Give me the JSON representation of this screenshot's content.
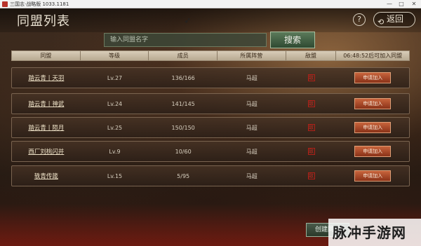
{
  "window": {
    "title": "三国志·战略版 1033.1181",
    "minimize": "—",
    "maximize": "□",
    "close": "✕"
  },
  "header": {
    "title": "同盟列表",
    "help": "?",
    "back_label": "返回",
    "back_icon": "⟲"
  },
  "search": {
    "placeholder": "输入同盟名字",
    "button": "搜索"
  },
  "columns": [
    "同盟",
    "等级",
    "成员",
    "所属阵营",
    "敌盟",
    "06:48:52后可加入同盟"
  ],
  "rows": [
    {
      "name": "踏云青丨天羽",
      "level": "Lv.27",
      "members": "136/166",
      "faction": "马超",
      "hostile": "敌",
      "action": "申请加入"
    },
    {
      "name": "踏云青丨神武",
      "level": "Lv.24",
      "members": "141/145",
      "faction": "马超",
      "hostile": "敌",
      "action": "申请加入"
    },
    {
      "name": "踏云青丨陨月",
      "level": "Lv.25",
      "members": "150/150",
      "faction": "马超",
      "hostile": "敌",
      "action": "申请加入"
    },
    {
      "name": "西厂刘桃闪并",
      "level": "Lv.9",
      "members": "10/60",
      "faction": "马超",
      "hostile": "敌",
      "action": "申请加入"
    },
    {
      "name": "轶青传箴",
      "level": "Lv.15",
      "members": "5/95",
      "faction": "马超",
      "hostile": "敌",
      "action": "申请加入"
    }
  ],
  "footer": {
    "create_button": "创建同盟",
    "watermark": "脉冲手游网"
  },
  "colors": {
    "apply": "#b04a28",
    "search": "#3f5e40",
    "hostile": "#c02a20"
  }
}
